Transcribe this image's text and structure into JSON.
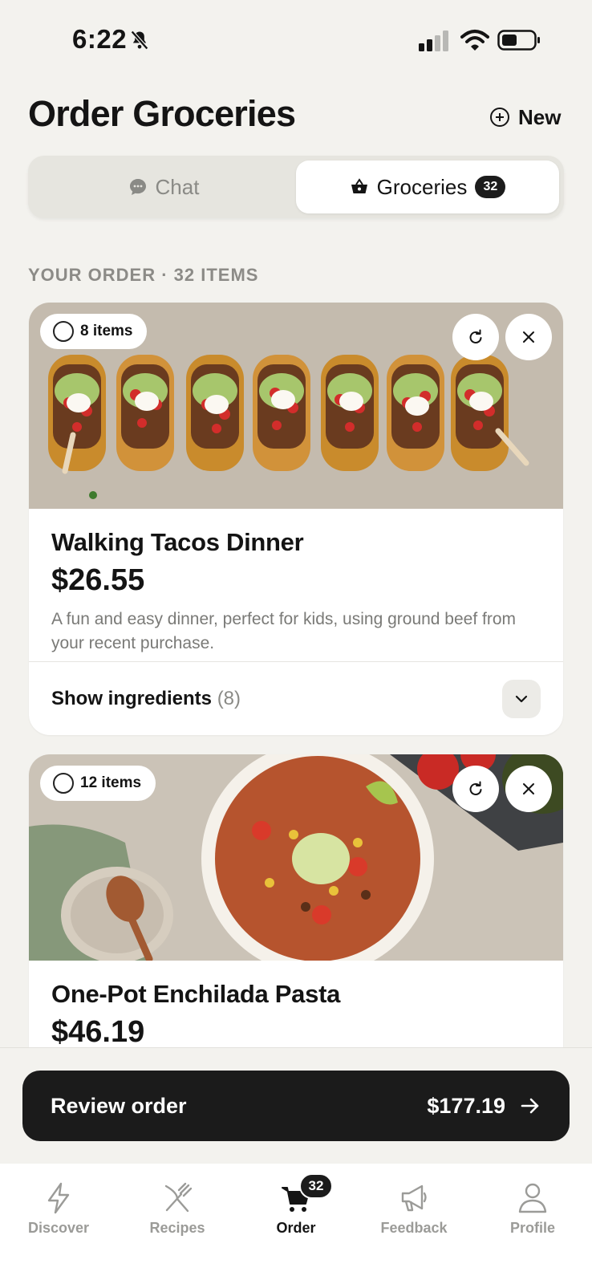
{
  "status_bar": {
    "time": "6:22"
  },
  "header": {
    "title": "Order Groceries",
    "new_label": "New"
  },
  "tabs": {
    "chat_label": "Chat",
    "groceries_label": "Groceries",
    "groceries_badge": "32",
    "selected": "Groceries"
  },
  "order": {
    "section_label": "YOUR ORDER · 32 ITEMS",
    "recipes": [
      {
        "items_label": "8 items",
        "title": "Walking Tacos Dinner",
        "price": "$26.55",
        "description": "A fun and easy dinner, perfect for kids, using ground beef from your recent purchase.",
        "ingredients_label": "Show ingredients",
        "ingredients_count": "(8)"
      },
      {
        "items_label": "12 items",
        "title": "One-Pot Enchilada Pasta",
        "price": "$46.19"
      }
    ]
  },
  "review": {
    "label": "Review order",
    "total": "$177.19"
  },
  "tab_bar": {
    "items": [
      {
        "label": "Discover",
        "icon": "lightning-icon"
      },
      {
        "label": "Recipes",
        "icon": "fork-knife-icon"
      },
      {
        "label": "Order",
        "icon": "cart-icon",
        "badge": "32",
        "active": true
      },
      {
        "label": "Feedback",
        "icon": "megaphone-icon"
      },
      {
        "label": "Profile",
        "icon": "person-icon"
      }
    ]
  },
  "colors": {
    "background": "#f3f2ee",
    "primary_dark": "#1b1b1b",
    "muted_text": "#8c8b87"
  }
}
